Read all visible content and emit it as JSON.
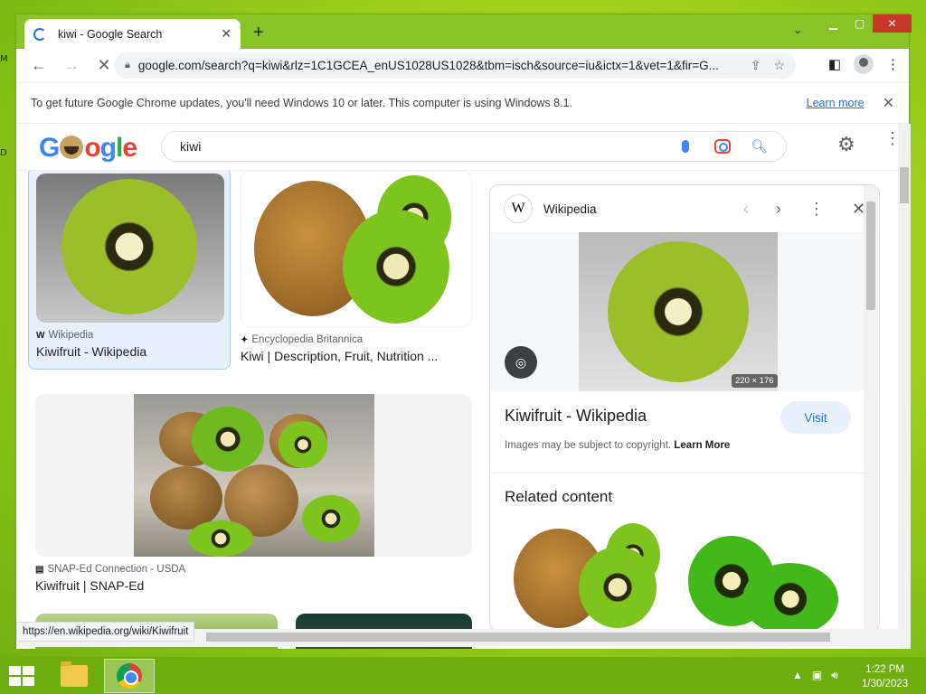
{
  "desktop": {
    "left_fragments": [
      "M",
      "D"
    ]
  },
  "browser": {
    "tab": {
      "title": "kiwi - Google Search"
    },
    "url": "google.com/search?q=kiwi&rlz=1C1GCEA_enUS1028US1028&tbm=isch&source=iu&ictx=1&vet=1&fir=G...",
    "infobar": {
      "message": "To get future Google Chrome updates, you'll need Windows 10 or later. This computer is using Windows 8.1.",
      "link": "Learn more"
    },
    "status_url": "https://en.wikipedia.org/wiki/Kiwifruit"
  },
  "search": {
    "query": "kiwi"
  },
  "results": [
    {
      "source": "Wikipedia",
      "title": "Kiwifruit - Wikipedia"
    },
    {
      "source": "Encyclopedia Britannica",
      "title": "Kiwi | Description, Fruit, Nutrition ..."
    },
    {
      "source": "SNAP-Ed Connection - USDA",
      "title": "Kiwifruit | SNAP-Ed"
    }
  ],
  "panel": {
    "source": "Wikipedia",
    "image_dims": "220 × 176",
    "title": "Kiwifruit - Wikipedia",
    "visit_label": "Visit",
    "copyright": "Images may be subject to copyright.",
    "copyright_link": "Learn More",
    "related_heading": "Related content"
  },
  "taskbar": {
    "time": "1:22 PM",
    "date": "1/30/2023"
  },
  "colors": {
    "accent_blue": "#1a73e8",
    "desktop_green": "#8ac328",
    "kiwi_flesh": "#8fb82a"
  }
}
